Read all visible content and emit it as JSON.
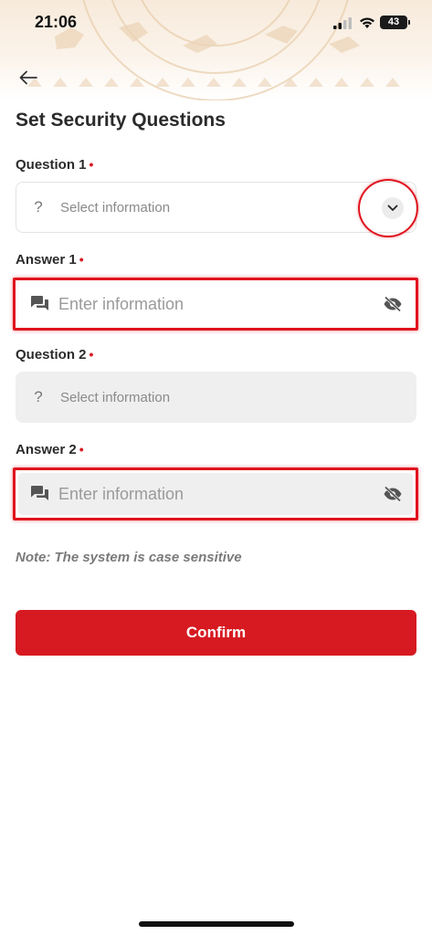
{
  "status_bar": {
    "time": "21:06",
    "battery": "43"
  },
  "page": {
    "title": "Set Security Questions"
  },
  "form": {
    "required_marker": "•",
    "question1": {
      "label": "Question 1",
      "placeholder": "Select information",
      "icon": "?"
    },
    "answer1": {
      "label": "Answer 1",
      "placeholder": "Enter information"
    },
    "question2": {
      "label": "Question 2",
      "placeholder": "Select information",
      "icon": "?"
    },
    "answer2": {
      "label": "Answer 2",
      "placeholder": "Enter information"
    },
    "note": "Note: The system is case sensitive",
    "confirm_label": "Confirm"
  },
  "colors": {
    "accent": "#d71a21",
    "highlight": "#e0141e",
    "disabled_field": "#efefef",
    "header_tint": "#f7eadb"
  },
  "icons": {
    "back": "arrow-left-icon",
    "chevron": "chevron-down-icon",
    "chat": "chat-bubbles-icon",
    "visibility": "eye-off-icon"
  }
}
